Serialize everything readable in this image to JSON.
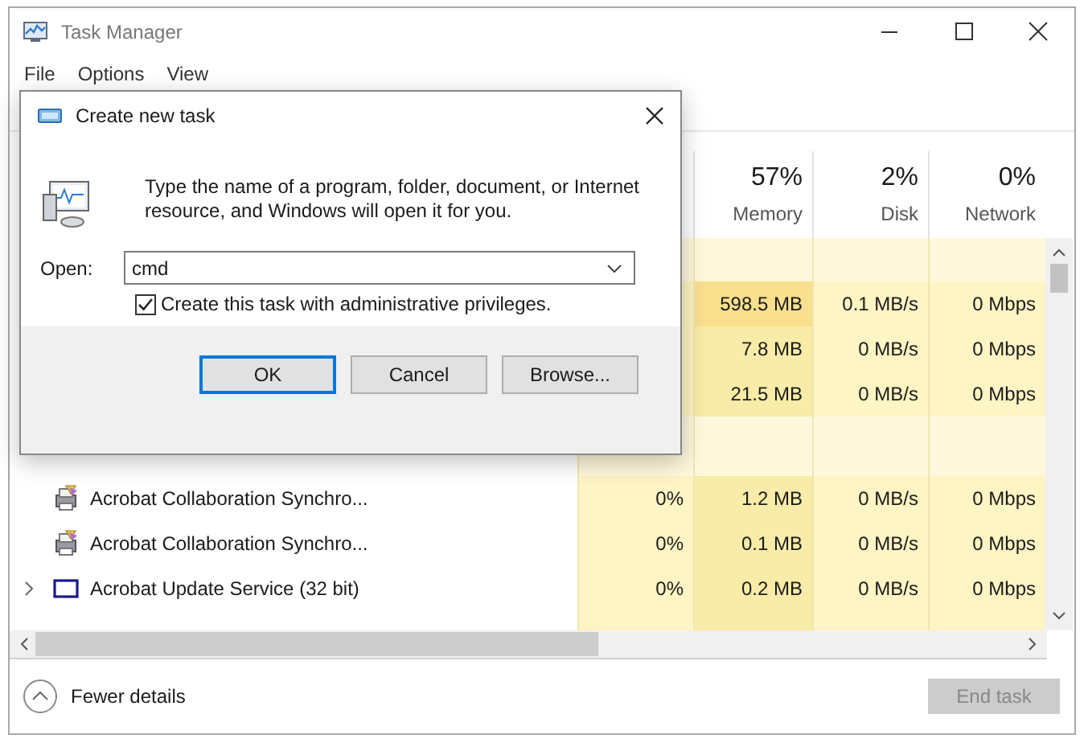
{
  "window": {
    "title": "Task Manager"
  },
  "menu": [
    "File",
    "Options",
    "View"
  ],
  "table": {
    "columns": [
      {
        "percent": "57%",
        "name": "Memory"
      },
      {
        "percent": "2%",
        "name": "Disk"
      },
      {
        "percent": "0%",
        "name": "Network"
      }
    ],
    "rows": [
      {
        "kind": "blank"
      },
      {
        "kind": "process",
        "memory": "598.5 MB",
        "disk": "0.1 MB/s",
        "network": "0 Mbps",
        "hot": true
      },
      {
        "kind": "process",
        "memory": "7.8 MB",
        "disk": "0 MB/s",
        "network": "0 Mbps",
        "hot": false
      },
      {
        "kind": "process",
        "memory": "21.5 MB",
        "disk": "0 MB/s",
        "network": "0 Mbps",
        "hot": false
      },
      {
        "kind": "group"
      },
      {
        "kind": "process",
        "expandable": false,
        "name": "Acrobat Collaboration Synchro...",
        "cpu": "0%",
        "memory": "1.2 MB",
        "disk": "0 MB/s",
        "network": "0 Mbps",
        "hot": false
      },
      {
        "kind": "process",
        "expandable": false,
        "name": "Acrobat Collaboration Synchro...",
        "cpu": "0%",
        "memory": "0.1 MB",
        "disk": "0 MB/s",
        "network": "0 Mbps",
        "hot": false
      },
      {
        "kind": "process",
        "expandable": true,
        "name": "Acrobat Update Service (32 bit)",
        "cpu": "0%",
        "memory": "0.2 MB",
        "disk": "0 MB/s",
        "network": "0 Mbps",
        "hot": false
      }
    ]
  },
  "footer": {
    "details": "Fewer details",
    "end_task": {
      "label": "End task",
      "disabled": true
    }
  },
  "dialog": {
    "title": "Create new task",
    "message": "Type the name of a program, folder, document, or Internet resource, and Windows will open it for you.",
    "open_label": "Open:",
    "value": "cmd",
    "admin": {
      "label": "Create this task with administrative privileges.",
      "checked": true
    },
    "buttons": [
      {
        "label": "OK",
        "default": true
      },
      {
        "label": "Cancel",
        "default": false
      },
      {
        "label": "Browse...",
        "default": false
      }
    ]
  }
}
